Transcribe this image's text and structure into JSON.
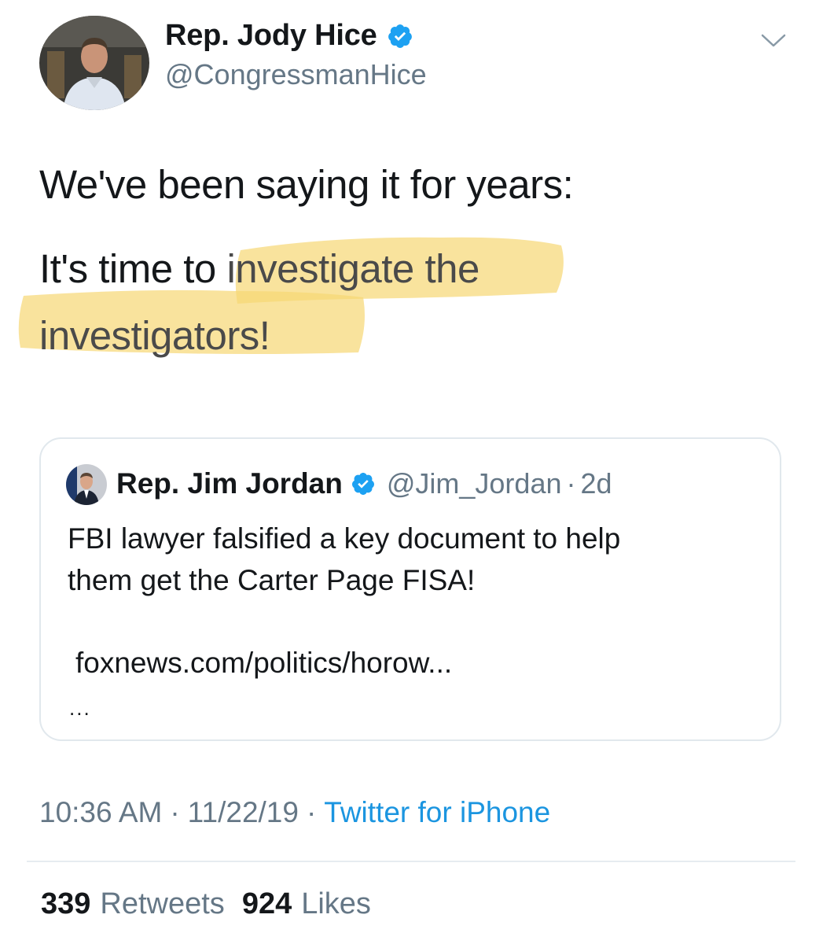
{
  "author": {
    "display_name": "Rep. Jody Hice",
    "handle": "@CongressmanHice",
    "verified_icon": "verified-badge-icon",
    "menu_icon": "chevron-down-icon"
  },
  "tweet": {
    "line1": "We've been saying it for years:",
    "line2_plain": "It's time to ",
    "line2_highlighted": "investigate the",
    "line3_highlighted": "investigators!",
    "highlight_color": "#f7d774"
  },
  "quoted_tweet": {
    "display_name": "Rep. Jim Jordan",
    "handle": "@Jim_Jordan",
    "separator": "·",
    "time": "2d",
    "text_line1": "FBI lawyer falsified a key document to help",
    "text_line2": "them get the Carter Page FISA!",
    "link": "foxnews.com/politics/horow...",
    "more": "..."
  },
  "meta": {
    "time": "10:36 AM",
    "date": "11/22/19",
    "separator": "·",
    "source": "Twitter for iPhone"
  },
  "stats": {
    "retweets_count": "339",
    "retweets_label": "Retweets",
    "likes_count": "924",
    "likes_label": "Likes"
  },
  "colors": {
    "verified_blue": "#1da1f2",
    "link_blue": "#1b95e0",
    "secondary_text": "#657786"
  }
}
